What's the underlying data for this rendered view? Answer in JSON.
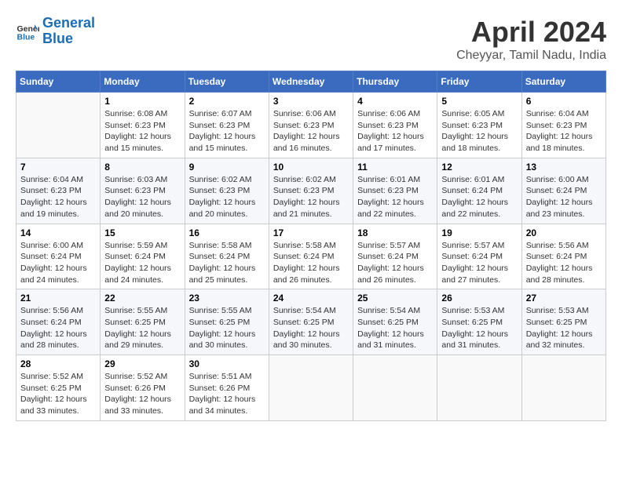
{
  "header": {
    "logo_line1": "General",
    "logo_line2": "Blue",
    "month_year": "April 2024",
    "location": "Cheyyar, Tamil Nadu, India"
  },
  "weekdays": [
    "Sunday",
    "Monday",
    "Tuesday",
    "Wednesday",
    "Thursday",
    "Friday",
    "Saturday"
  ],
  "weeks": [
    [
      {
        "day": "",
        "info": ""
      },
      {
        "day": "1",
        "info": "Sunrise: 6:08 AM\nSunset: 6:23 PM\nDaylight: 12 hours\nand 15 minutes."
      },
      {
        "day": "2",
        "info": "Sunrise: 6:07 AM\nSunset: 6:23 PM\nDaylight: 12 hours\nand 15 minutes."
      },
      {
        "day": "3",
        "info": "Sunrise: 6:06 AM\nSunset: 6:23 PM\nDaylight: 12 hours\nand 16 minutes."
      },
      {
        "day": "4",
        "info": "Sunrise: 6:06 AM\nSunset: 6:23 PM\nDaylight: 12 hours\nand 17 minutes."
      },
      {
        "day": "5",
        "info": "Sunrise: 6:05 AM\nSunset: 6:23 PM\nDaylight: 12 hours\nand 18 minutes."
      },
      {
        "day": "6",
        "info": "Sunrise: 6:04 AM\nSunset: 6:23 PM\nDaylight: 12 hours\nand 18 minutes."
      }
    ],
    [
      {
        "day": "7",
        "info": "Sunrise: 6:04 AM\nSunset: 6:23 PM\nDaylight: 12 hours\nand 19 minutes."
      },
      {
        "day": "8",
        "info": "Sunrise: 6:03 AM\nSunset: 6:23 PM\nDaylight: 12 hours\nand 20 minutes."
      },
      {
        "day": "9",
        "info": "Sunrise: 6:02 AM\nSunset: 6:23 PM\nDaylight: 12 hours\nand 20 minutes."
      },
      {
        "day": "10",
        "info": "Sunrise: 6:02 AM\nSunset: 6:23 PM\nDaylight: 12 hours\nand 21 minutes."
      },
      {
        "day": "11",
        "info": "Sunrise: 6:01 AM\nSunset: 6:23 PM\nDaylight: 12 hours\nand 22 minutes."
      },
      {
        "day": "12",
        "info": "Sunrise: 6:01 AM\nSunset: 6:24 PM\nDaylight: 12 hours\nand 22 minutes."
      },
      {
        "day": "13",
        "info": "Sunrise: 6:00 AM\nSunset: 6:24 PM\nDaylight: 12 hours\nand 23 minutes."
      }
    ],
    [
      {
        "day": "14",
        "info": "Sunrise: 6:00 AM\nSunset: 6:24 PM\nDaylight: 12 hours\nand 24 minutes."
      },
      {
        "day": "15",
        "info": "Sunrise: 5:59 AM\nSunset: 6:24 PM\nDaylight: 12 hours\nand 24 minutes."
      },
      {
        "day": "16",
        "info": "Sunrise: 5:58 AM\nSunset: 6:24 PM\nDaylight: 12 hours\nand 25 minutes."
      },
      {
        "day": "17",
        "info": "Sunrise: 5:58 AM\nSunset: 6:24 PM\nDaylight: 12 hours\nand 26 minutes."
      },
      {
        "day": "18",
        "info": "Sunrise: 5:57 AM\nSunset: 6:24 PM\nDaylight: 12 hours\nand 26 minutes."
      },
      {
        "day": "19",
        "info": "Sunrise: 5:57 AM\nSunset: 6:24 PM\nDaylight: 12 hours\nand 27 minutes."
      },
      {
        "day": "20",
        "info": "Sunrise: 5:56 AM\nSunset: 6:24 PM\nDaylight: 12 hours\nand 28 minutes."
      }
    ],
    [
      {
        "day": "21",
        "info": "Sunrise: 5:56 AM\nSunset: 6:24 PM\nDaylight: 12 hours\nand 28 minutes."
      },
      {
        "day": "22",
        "info": "Sunrise: 5:55 AM\nSunset: 6:25 PM\nDaylight: 12 hours\nand 29 minutes."
      },
      {
        "day": "23",
        "info": "Sunrise: 5:55 AM\nSunset: 6:25 PM\nDaylight: 12 hours\nand 30 minutes."
      },
      {
        "day": "24",
        "info": "Sunrise: 5:54 AM\nSunset: 6:25 PM\nDaylight: 12 hours\nand 30 minutes."
      },
      {
        "day": "25",
        "info": "Sunrise: 5:54 AM\nSunset: 6:25 PM\nDaylight: 12 hours\nand 31 minutes."
      },
      {
        "day": "26",
        "info": "Sunrise: 5:53 AM\nSunset: 6:25 PM\nDaylight: 12 hours\nand 31 minutes."
      },
      {
        "day": "27",
        "info": "Sunrise: 5:53 AM\nSunset: 6:25 PM\nDaylight: 12 hours\nand 32 minutes."
      }
    ],
    [
      {
        "day": "28",
        "info": "Sunrise: 5:52 AM\nSunset: 6:25 PM\nDaylight: 12 hours\nand 33 minutes."
      },
      {
        "day": "29",
        "info": "Sunrise: 5:52 AM\nSunset: 6:26 PM\nDaylight: 12 hours\nand 33 minutes."
      },
      {
        "day": "30",
        "info": "Sunrise: 5:51 AM\nSunset: 6:26 PM\nDaylight: 12 hours\nand 34 minutes."
      },
      {
        "day": "",
        "info": ""
      },
      {
        "day": "",
        "info": ""
      },
      {
        "day": "",
        "info": ""
      },
      {
        "day": "",
        "info": ""
      }
    ]
  ]
}
